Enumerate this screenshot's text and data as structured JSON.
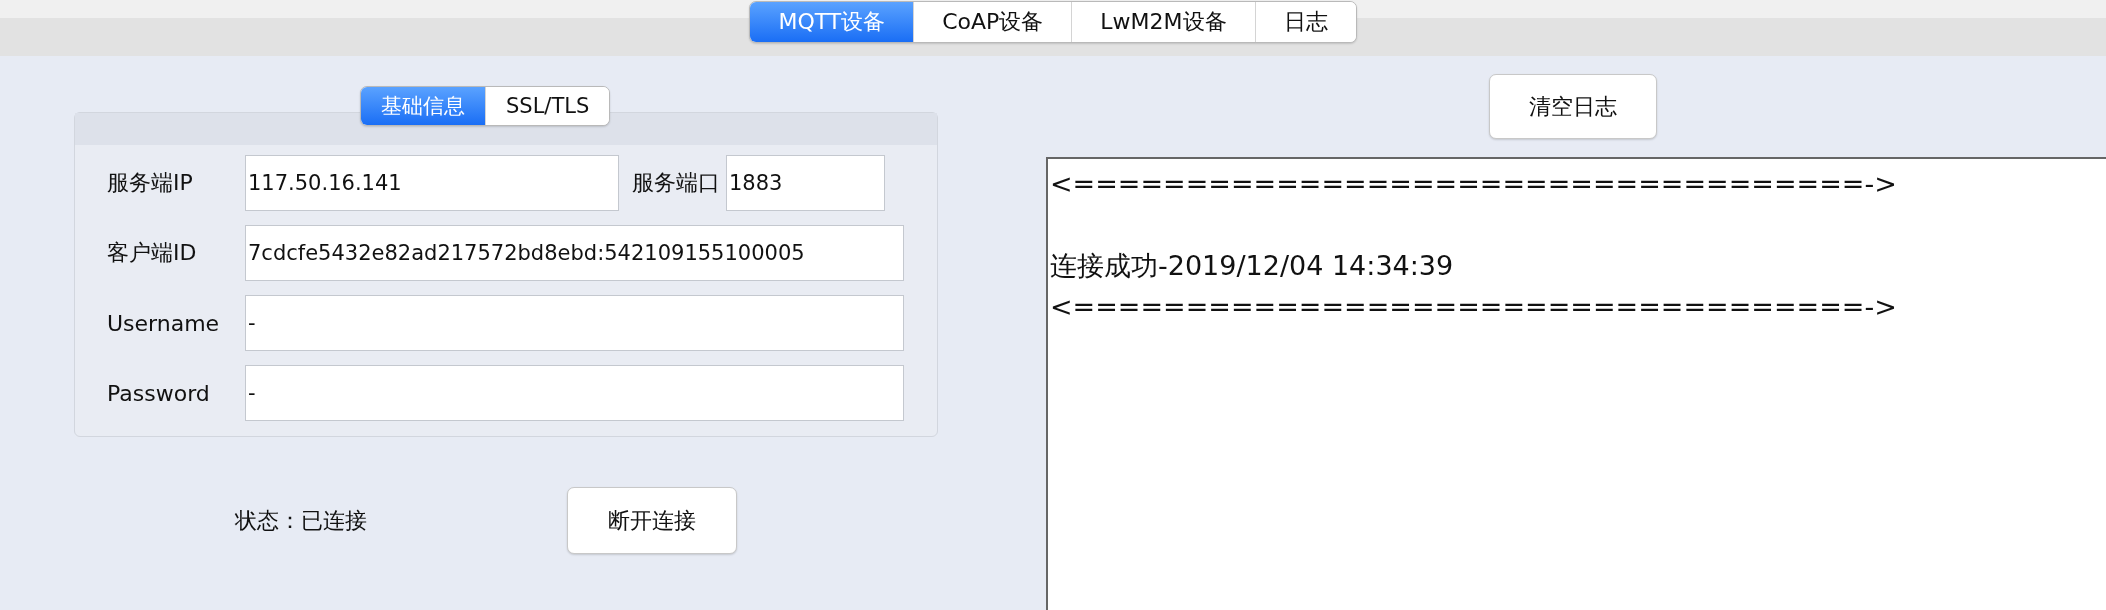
{
  "tabs": [
    {
      "label": "MQTT设备",
      "selected": true
    },
    {
      "label": "CoAP设备",
      "selected": false
    },
    {
      "label": "LwM2M设备",
      "selected": false
    },
    {
      "label": "日志",
      "selected": false
    }
  ],
  "connection_panel": {
    "tabs": [
      {
        "label": "基础信息",
        "selected": true
      },
      {
        "label": "SSL/TLS",
        "selected": false
      }
    ],
    "server_ip": {
      "label": "服务端IP",
      "value": "117.50.16.141"
    },
    "server_port": {
      "label": "服务端口",
      "value": "1883"
    },
    "fields": [
      {
        "label": "客户端ID",
        "value": "7cdcfe5432e82ad217572bd8ebd:542109155100005"
      },
      {
        "label": "Username",
        "value": "-"
      },
      {
        "label": "Password",
        "value": "-"
      }
    ]
  },
  "status": "状态：已连接",
  "disconnect_button": "断开连接",
  "clear_log_button": "清空日志",
  "log_text": "<===================================->\n\n连接成功-2019/12/04 14:34:39\n<===================================->"
}
